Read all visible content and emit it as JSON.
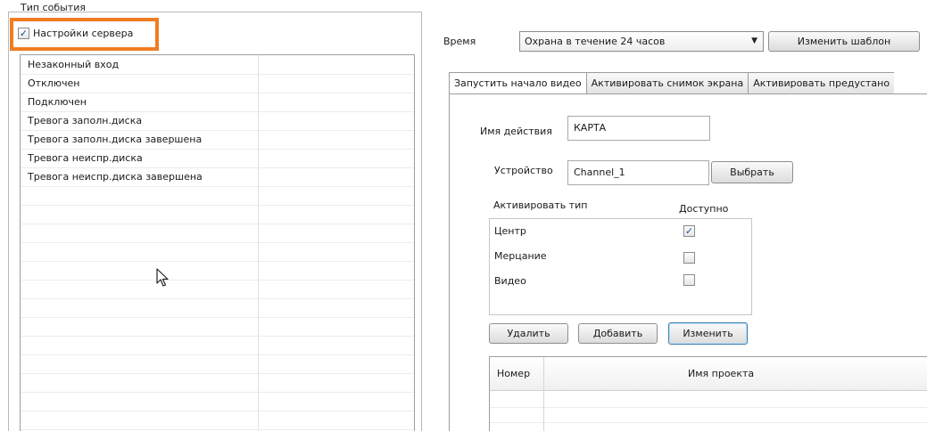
{
  "event_group": {
    "title": "Тип события",
    "server_settings": {
      "label": "Настройки сервера",
      "checked": true
    },
    "events": [
      "Незаконный вход",
      "Отключен",
      "Подключен",
      "Тревога заполн.диска",
      "Тревога заполн.диска завершена",
      "Тревога неиспр.диска",
      "Тревога неиспр.диска завершена"
    ]
  },
  "schedule": {
    "label": "Время",
    "selected": "Охрана в течение 24 часов",
    "change_template": "Изменить шаблон"
  },
  "tabs": [
    {
      "label": "Запустить начало видео",
      "active": true
    },
    {
      "label": "Активировать снимок экрана",
      "active": false
    },
    {
      "label": "Активировать предустано",
      "active": false
    }
  ],
  "action": {
    "name_label": "Имя действия",
    "name_value": "КАРТА",
    "device_label": "Устройство",
    "device_value": "Channel_1",
    "select_button": "Выбрать",
    "activate_type_label": "Активировать тип",
    "available_label": "Доступно",
    "types": [
      {
        "label": "Центр",
        "checked": true
      },
      {
        "label": "Мерцание",
        "checked": false
      },
      {
        "label": "Видео",
        "checked": false
      }
    ],
    "delete_button": "Удалить",
    "add_button": "Добавить",
    "edit_button": "Изменить"
  },
  "project_table": {
    "columns": [
      "Номер",
      "Имя проекта"
    ]
  },
  "colors": {
    "highlight": "#f07d22",
    "check_mark": "#1c4fa3"
  }
}
